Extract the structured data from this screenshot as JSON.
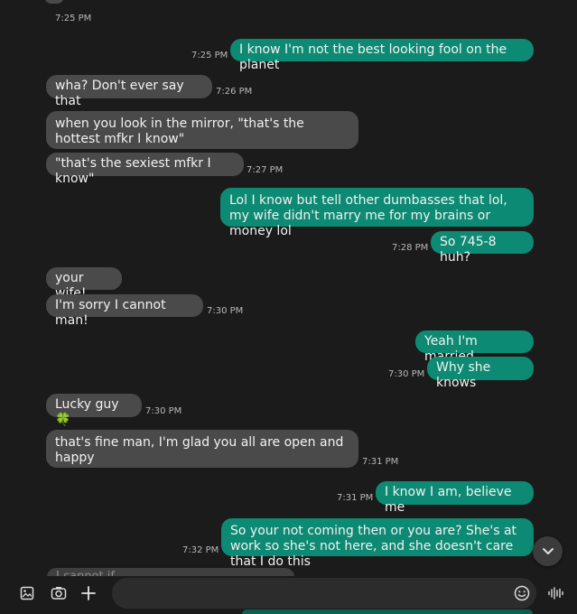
{
  "messages": [
    {
      "dir": "out",
      "text": "I know I'm not the best looking fool on the planet",
      "time": "7:25 PM"
    },
    {
      "dir": "in",
      "text": "wha?  Don't ever say that",
      "time": "7:26 PM"
    },
    {
      "dir": "in",
      "text": "when you look in the mirror, \"that's the hottest mfkr I know\"",
      "time": ""
    },
    {
      "dir": "in",
      "text": "\"that's the sexiest mfkr I know\"",
      "time": "7:27 PM"
    },
    {
      "dir": "out",
      "text": "Lol I know but tell other dumbasses that lol, my wife didn't marry me for my brains or money lol",
      "time": ""
    },
    {
      "dir": "out",
      "text": "So 745-8 huh?",
      "time": "7:28 PM"
    },
    {
      "dir": "in",
      "text": "your wife!",
      "time": ""
    },
    {
      "dir": "in",
      "text": "I'm sorry I cannot man!",
      "time": "7:30 PM"
    },
    {
      "dir": "out",
      "text": "Yeah I'm married",
      "time": ""
    },
    {
      "dir": "out",
      "text": "Why she knows",
      "time": "7:30 PM"
    },
    {
      "dir": "in",
      "text": "Lucky guy 🍀",
      "time": "7:30 PM"
    },
    {
      "dir": "in",
      "text": "that's fine man, I'm glad you all are open and happy",
      "time": "7:31 PM"
    },
    {
      "dir": "out",
      "text": "I know I am,  believe me",
      "time": "7:31 PM"
    },
    {
      "dir": "out",
      "text": "So your not coming then or you are?  She's at work so she's not here, and she doesn't care that I do this",
      "time": "7:32 PM"
    }
  ],
  "top_timestamp": "7:25 PM",
  "partial_next_message": "I cannot if",
  "composer": {
    "placeholder": "",
    "icons": [
      "gallery-icon",
      "camera-icon",
      "plus-icon",
      "emoji-icon",
      "voice-icon"
    ]
  },
  "colors": {
    "background": "#1b1b1b",
    "incoming_bubble": "#4a4a4a",
    "outgoing_bubble": "#0d8a73",
    "timestamp": "#b8b8b8"
  }
}
